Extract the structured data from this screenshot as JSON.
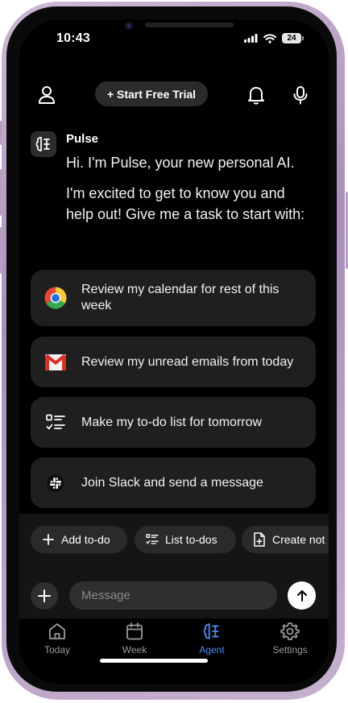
{
  "status": {
    "time": "10:43",
    "battery": "24"
  },
  "header": {
    "trial_label": "+ Start Free Trial"
  },
  "assistant": {
    "name": "Pulse",
    "greeting": "Hi. I'm Pulse, your new personal AI.",
    "intro": "I'm excited to get to know you and help out! Give me a task to start with:"
  },
  "tasks": [
    {
      "label": "Review my calendar for rest of this week",
      "icon": "chrome-icon"
    },
    {
      "label": "Review my unread emails from today",
      "icon": "gmail-icon"
    },
    {
      "label": "Make my to-do list for tomorrow",
      "icon": "checklist-icon"
    },
    {
      "label": "Join Slack and send a message",
      "icon": "slack-icon"
    }
  ],
  "chips": [
    {
      "label": "Add to-do",
      "icon": "plus-icon"
    },
    {
      "label": "List to-dos",
      "icon": "list-icon"
    },
    {
      "label": "Create not",
      "icon": "note-add-icon"
    }
  ],
  "composer": {
    "placeholder": "Message"
  },
  "tabs": [
    {
      "label": "Today",
      "icon": "home-icon",
      "active": false
    },
    {
      "label": "Week",
      "icon": "calendar-icon",
      "active": false
    },
    {
      "label": "Agent",
      "icon": "agent-icon",
      "active": true
    },
    {
      "label": "Settings",
      "icon": "gear-icon",
      "active": false
    }
  ],
  "colors": {
    "accent": "#4a8cf0",
    "background": "#000000",
    "card": "#1f1f1f",
    "frame": "#b79fc4"
  }
}
